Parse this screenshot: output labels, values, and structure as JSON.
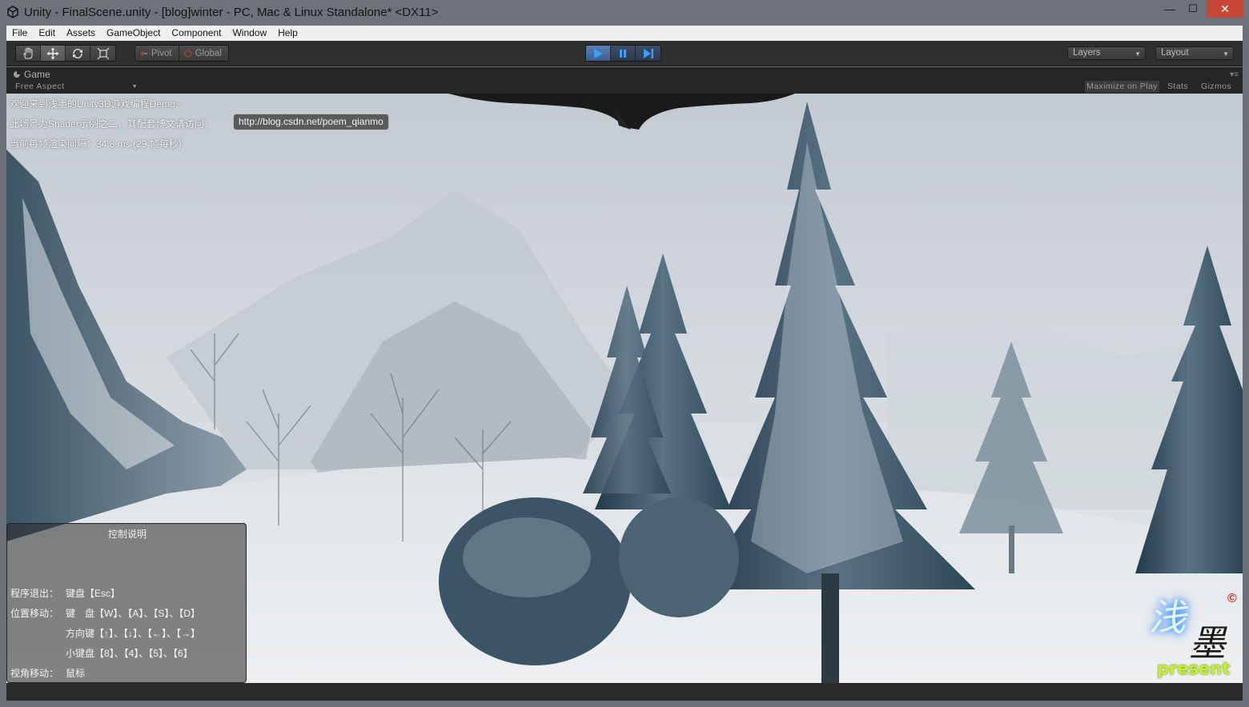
{
  "window": {
    "title": "Unity - FinalScene.unity - [blog]winter - PC, Mac & Linux Standalone* <DX11>",
    "minimize_glyph": "—",
    "maximize_glyph": "☐",
    "close_glyph": "✕"
  },
  "menu": {
    "items": [
      {
        "label": "File"
      },
      {
        "label": "Edit"
      },
      {
        "label": "Assets"
      },
      {
        "label": "GameObject"
      },
      {
        "label": "Component"
      },
      {
        "label": "Window"
      },
      {
        "label": "Help"
      }
    ]
  },
  "toolbar": {
    "tools": [
      {
        "icon": "hand-icon"
      },
      {
        "icon": "move-icon"
      },
      {
        "icon": "rotate-icon"
      },
      {
        "icon": "scale-icon"
      }
    ],
    "pivot_label": "Pivot",
    "global_label": "Global",
    "layers_label": "Layers",
    "layout_label": "Layout"
  },
  "panel": {
    "tab_label": "Game",
    "aspect_label": "Free Aspect",
    "maximize_on_play_label": "Maximize on Play",
    "stats_label": "Stats",
    "gizmos_label": "Gizmos"
  },
  "hud": {
    "welcome": "欢迎来到浅墨的Unity3D游戏编程Demo~",
    "shader_note": "此场景为Shader示例之二，其配套博文请访问：",
    "link": "http://blog.csdn.net/poem_qianmo",
    "frame_time": "当前每帧渲染间隔：34.8 ms (29 帧每秒)"
  },
  "help": {
    "title": "控制说明",
    "exit_label": "程序退出：",
    "exit_keys": "键盘【Esc】",
    "move_label": "位置移动：",
    "move_keys_1": "键　盘【W】、【A】、【S】、【D】",
    "move_keys_2": "方向键【↑】、【↓】、【←】、【→】",
    "move_keys_3": "小键盘【8】、【4】、【5】、【6】",
    "view_label": "视角移动：",
    "view_keys": "鼠标"
  },
  "logo": {
    "text_top": "浅",
    "text_bottom": "墨",
    "sub": "present",
    "mark": "©"
  },
  "colors": {
    "title_bar": "#6e727a",
    "close_button": "#c7463a",
    "editor_dark": "#2f2f2f",
    "play_active": "#4a73a8",
    "snow": "#e4e7ea",
    "tree": "#2a4556"
  }
}
